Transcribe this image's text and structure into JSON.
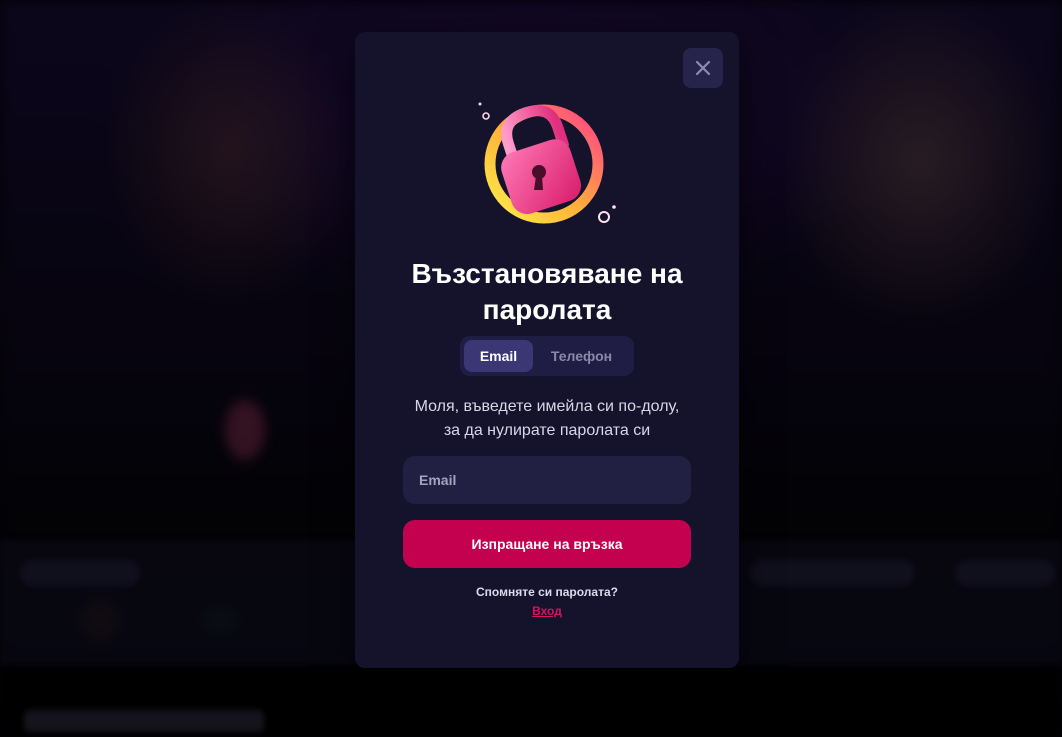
{
  "modal": {
    "title": "Възстановяване на паролата",
    "close_icon": "close-icon",
    "hero_icon": "padlock-icon",
    "tabs": [
      {
        "label": "Email",
        "active": true
      },
      {
        "label": "Телефон",
        "active": false
      }
    ],
    "instruction": {
      "line1": "Моля, въведете имейла си по-долу,",
      "line2": "за да нулирате паролата си"
    },
    "email_field": {
      "placeholder": "Email",
      "value": ""
    },
    "submit_label": "Изпращане на връзка",
    "remember_text": "Спомняте си паролата?",
    "login_link_label": "Вход"
  },
  "colors": {
    "modal_bg": "#15132c",
    "accent": "#c4014e",
    "link": "#d4145e",
    "tab_active": "#3b3774"
  }
}
